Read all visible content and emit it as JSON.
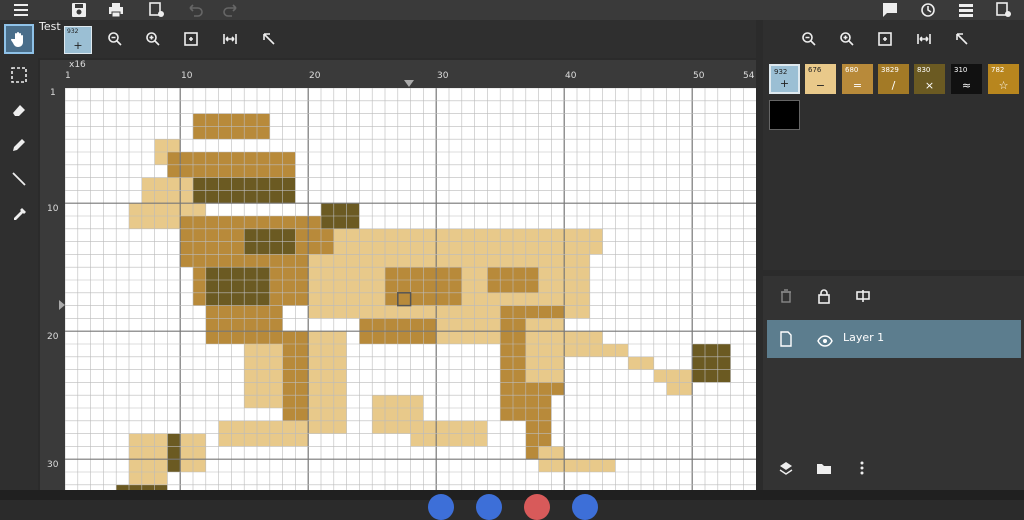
{
  "topbar": {
    "icons": [
      "menu-icon",
      "save-icon",
      "print-icon",
      "image-settings-icon",
      "undo-icon",
      "redo-icon",
      "comment-icon",
      "history-icon",
      "list-icon",
      "page-settings-icon"
    ]
  },
  "tools": [
    "hand-icon",
    "select-icon",
    "eraser-icon",
    "pencil-icon",
    "line-icon",
    "eyedropper-icon"
  ],
  "palette_bar": {
    "label": "Test",
    "selected": {
      "number": "932",
      "symbol": "+",
      "color": "#9bbfd4"
    }
  },
  "canvas": {
    "zoom": "x16",
    "ruler_top": [
      "1",
      "10",
      "20",
      "30",
      "40",
      "50",
      "54"
    ],
    "ruler_left": [
      "1",
      "10",
      "20",
      "30"
    ]
  },
  "palette": [
    {
      "number": "932",
      "symbol": "+",
      "color": "#9bbfd4",
      "text": "#222222"
    },
    {
      "number": "676",
      "symbol": "−",
      "color": "#e9c98a",
      "text": "#222222"
    },
    {
      "number": "680",
      "symbol": "=",
      "color": "#b88a3a",
      "text": "#ffffff"
    },
    {
      "number": "3829",
      "symbol": "/",
      "color": "#a37a26",
      "text": "#ffffff"
    },
    {
      "number": "830",
      "symbol": "×",
      "color": "#6b5a22",
      "text": "#ffffff"
    },
    {
      "number": "310",
      "symbol": "≈",
      "color": "#111111",
      "text": "#ffffff"
    },
    {
      "number": "782",
      "symbol": "☆",
      "color": "#b8861e",
      "text": "#ffffff"
    }
  ],
  "layers": {
    "items": [
      {
        "name": "Layer 1"
      }
    ]
  },
  "colors": {
    "light": "#e8c98a",
    "mid": "#b88a3a",
    "dark": "#6b5a22",
    "accent": "#4a6e8a"
  }
}
